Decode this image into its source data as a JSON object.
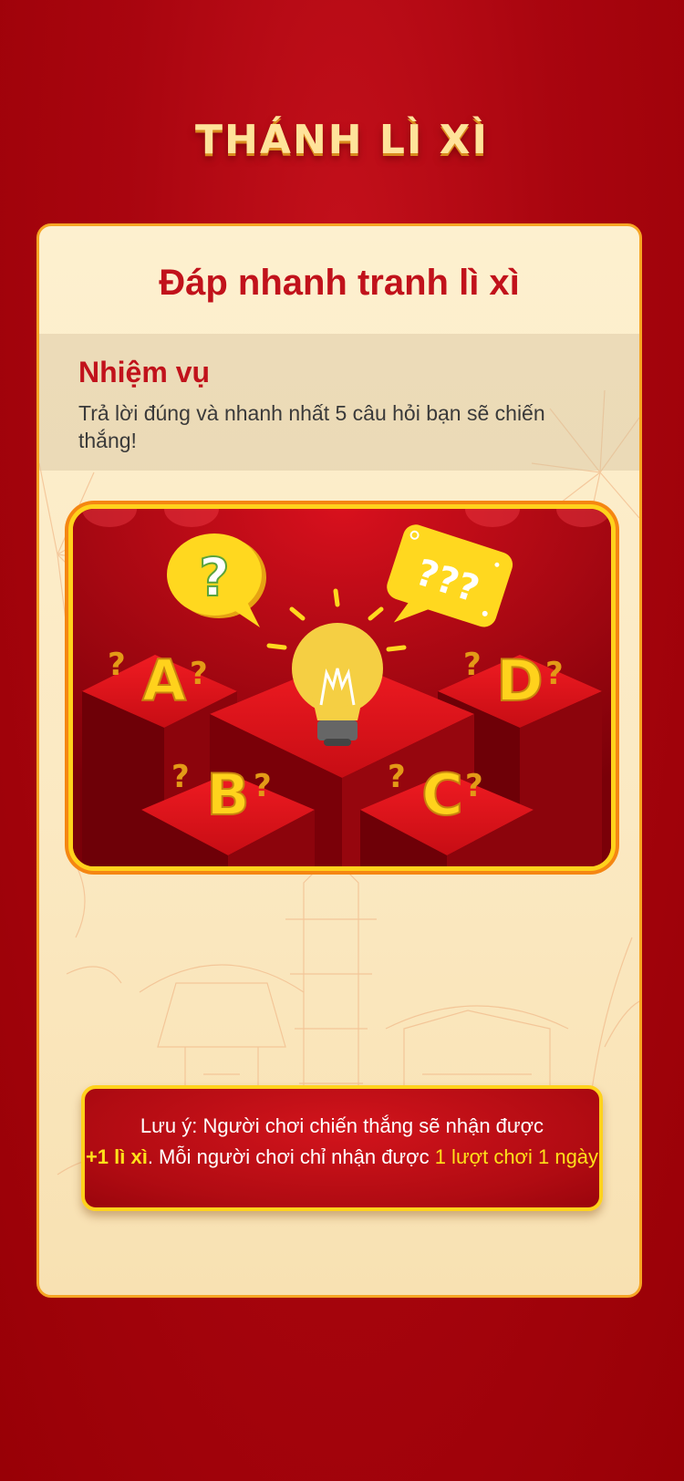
{
  "header": {
    "title": "THÁNH LÌ XÌ"
  },
  "card": {
    "title": "Đáp nhanh tranh lì xì",
    "mission": {
      "heading": "Nhiệm vụ",
      "text": "Trả lời đúng và nhanh nhất 5 câu hỏi bạn sẽ chiến thắng!"
    },
    "illustration": {
      "options": [
        "A",
        "B",
        "C",
        "D"
      ],
      "question_mark": "?",
      "bubble_text": "???"
    },
    "note": {
      "line1": "Lưu ý: Người chơi chiến thắng sẽ nhận được",
      "reward": "+1 lì xì",
      "middle": ". Mỗi người chơi chỉ nhận được ",
      "limit": "1 lượt chơi 1 ngày"
    }
  },
  "colors": {
    "background": "#a9050f",
    "accent_red": "#c1121b",
    "gold": "#ffd21c",
    "card": "#fdf0cf"
  }
}
